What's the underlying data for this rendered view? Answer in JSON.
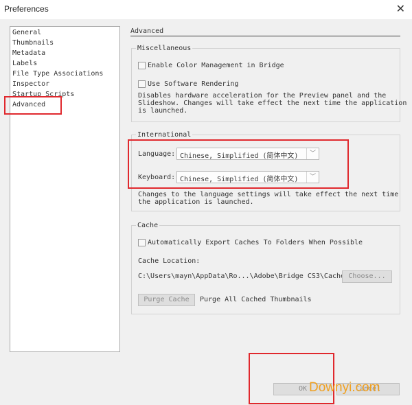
{
  "window": {
    "title": "Preferences",
    "close_icon": "close-icon"
  },
  "sidebar": {
    "items": [
      {
        "label": "General"
      },
      {
        "label": "Thumbnails"
      },
      {
        "label": "Metadata"
      },
      {
        "label": "Labels"
      },
      {
        "label": "File Type Associations"
      },
      {
        "label": "Inspector"
      },
      {
        "label": "Startup Scripts"
      },
      {
        "label": "Advanced",
        "selected": true
      }
    ]
  },
  "panel": {
    "heading": "Advanced"
  },
  "misc": {
    "title": "Miscellaneous",
    "color_mgmt_label": "Enable Color Management in Bridge",
    "color_mgmt_checked": false,
    "software_render_label": "Use Software Rendering",
    "software_render_checked": false,
    "software_render_note_1": "Disables hardware acceleration for the Preview panel and the",
    "software_render_note_2": "Slideshow. Changes will take effect the next time the application",
    "software_render_note_3": "is launched."
  },
  "international": {
    "title": "International",
    "language_label": "Language:",
    "language_value": "Chinese, Simplified (简体中文)",
    "keyboard_label": "Keyboard:",
    "keyboard_value": "Chinese, Simplified (简体中文)",
    "note_1": "Changes to the language settings will take effect the next time",
    "note_2": "the application is launched."
  },
  "cache": {
    "title": "Cache",
    "auto_export_label": "Automatically Export Caches To Folders When Possible",
    "auto_export_checked": false,
    "location_label": "Cache Location:",
    "location_path": "C:\\Users\\mayn\\AppData\\Ro...\\Adobe\\Bridge CS3\\Cache\\",
    "choose_label": "Choose...",
    "purge_button_label": "Purge Cache",
    "purge_desc": "Purge All Cached Thumbnails"
  },
  "footer": {
    "ok_label": "OK",
    "cancel_label": "Cancel"
  },
  "annotation_color": "#e0282d",
  "watermark": {
    "text": "Downyi.com",
    "color": "#f0a020"
  }
}
